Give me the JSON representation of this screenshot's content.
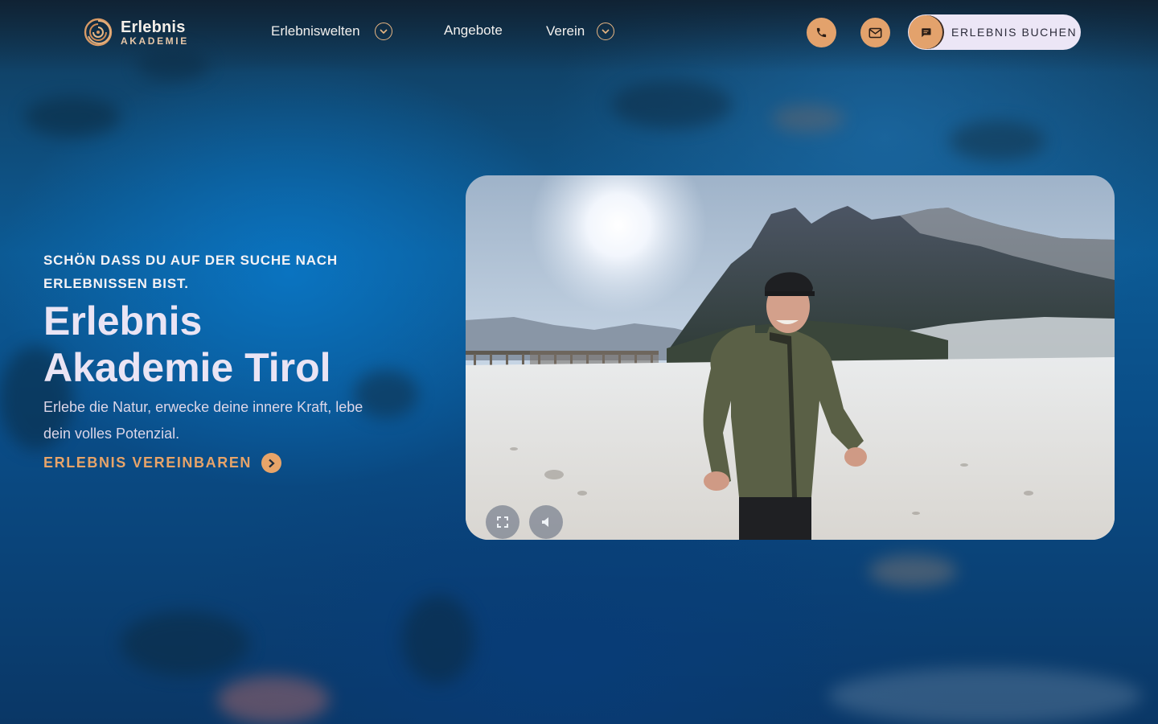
{
  "brand": {
    "name_line1": "Erlebnis",
    "name_line2": "AKADEMIE"
  },
  "nav": {
    "items": [
      {
        "label": "Erlebniswelten",
        "has_dropdown": true
      },
      {
        "label": "Angebote",
        "has_dropdown": false
      },
      {
        "label": "Verein",
        "has_dropdown": true
      }
    ]
  },
  "actions": {
    "phone_icon": "phone-icon",
    "mail_icon": "mail-icon",
    "book_icon": "chat-icon",
    "book_label": "ERLEBNIS BUCHEN"
  },
  "hero": {
    "eyebrow": "SCHÖN DASS DU AUF DER SUCHE NACH ERLEBNISSEN BIST.",
    "title_line1": "Erlebnis",
    "title_line2": "Akademie Tirol",
    "subtitle": "Erlebe die Natur, erwecke deine innere Kraft, lebe dein volles Potenzial.",
    "cta_label": "ERLEBNIS VEREINBAREN"
  },
  "video": {
    "controls": [
      "fullscreen-icon",
      "volume-icon"
    ]
  },
  "colors": {
    "accent": "#e3a26c",
    "cta_text": "#e7a469",
    "button_bg": "#ece6f6",
    "title": "#eae4f4"
  }
}
